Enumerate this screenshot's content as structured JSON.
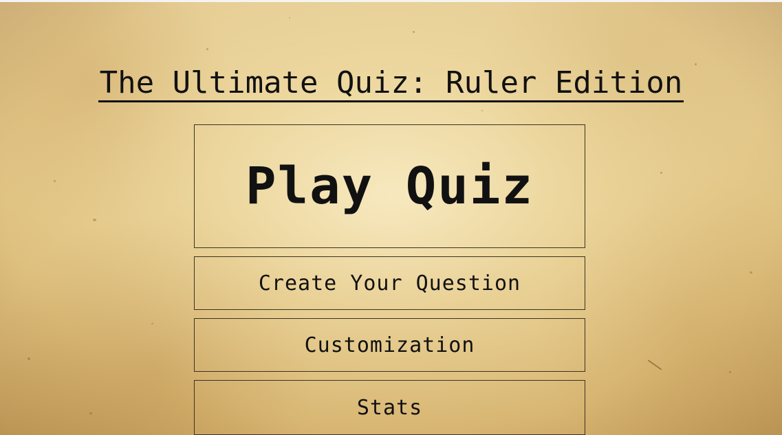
{
  "title": "The Ultimate Quiz: Ruler Edition",
  "menu": {
    "play_label": "Play Quiz",
    "create_label": "Create Your Question",
    "customization_label": "Customization",
    "stats_label": "Stats"
  },
  "colors": {
    "paper": "#e6cf94",
    "text": "#111111",
    "border": "#3a3222"
  }
}
